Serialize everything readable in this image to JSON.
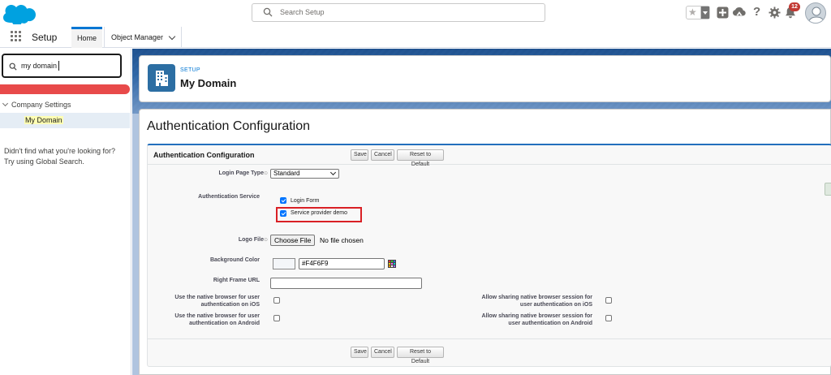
{
  "header": {
    "search_placeholder": "Search Setup",
    "notification_count": "12",
    "icons": [
      "salesforce-cloud-icon",
      "search-icon",
      "favorites-star-icon",
      "add-icon",
      "trailhead-icon",
      "help-icon",
      "setup-gear-icon",
      "notification-bell-icon",
      "avatar"
    ]
  },
  "context_bar": {
    "app_name": "Setup",
    "tabs": [
      {
        "label": "Home",
        "active": true
      },
      {
        "label": "Object Manager",
        "active": false
      }
    ]
  },
  "sidebar": {
    "quick_find_value": "my domain",
    "tree": {
      "parent": "Company Settings",
      "child": "My Domain"
    },
    "not_found_line1": "Didn't find what you're looking for?",
    "not_found_line2": "Try using Global Search."
  },
  "page_header": {
    "eyebrow": "SETUP",
    "title": "My Domain"
  },
  "content": {
    "title": "Authentication Configuration",
    "block": {
      "title": "Authentication Configuration",
      "buttons": {
        "save": "Save",
        "cancel": "Cancel",
        "reset": "Reset to Default"
      },
      "fields": {
        "login_page_type_label": "Login Page Type",
        "login_page_type_value": "Standard",
        "auth_service_label": "Authentication Service",
        "auth_options": [
          {
            "label": "Login Form",
            "checked": true
          },
          {
            "label": "Service provider demo",
            "checked": true
          }
        ],
        "logo_file_label": "Logo File",
        "choose_file": "Choose File",
        "no_file": "No file chosen",
        "bg_color_label": "Background Color",
        "bg_color_value": "#F4F6F9",
        "right_frame_label": "Right Frame URL",
        "right_frame_value": "",
        "native_ios_label_1": "Use the native browser for user",
        "native_ios_label_2": "authentication on iOS",
        "native_android_label_1": "Use the native browser for user",
        "native_android_label_2": "authentication on Android",
        "share_ios_label_1": "Allow sharing native browser session for",
        "share_ios_label_2": "user authentication on iOS",
        "share_android_label_1": "Allow sharing native browser session for",
        "share_android_label_2": "user authentication on Android"
      }
    }
  },
  "colors": {
    "brand_blue": "#0176d3",
    "cloud_blue": "#00a1e0",
    "highlight_red": "#d92025",
    "sidebar_red_bar": "#e84a4a"
  }
}
